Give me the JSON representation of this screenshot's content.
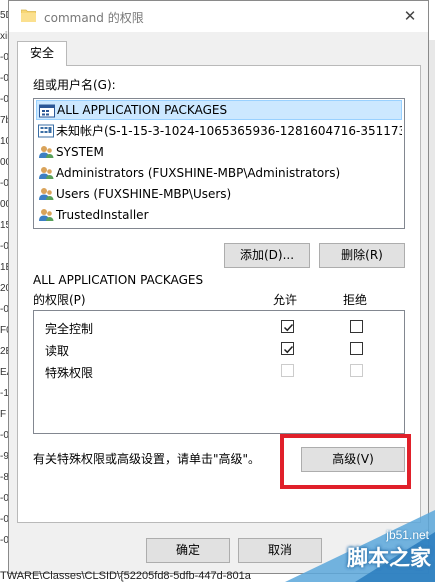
{
  "window": {
    "title": "command 的权限",
    "close_glyph": "✕"
  },
  "tabs": [
    {
      "label": "安全",
      "active": true
    }
  ],
  "group_label": "组或用户名(G):",
  "principals": [
    {
      "name": "ALL APPLICATION PACKAGES",
      "icon": "app-packages-icon",
      "selected": true
    },
    {
      "name": "未知帐户(S-1-15-3-1024-1065365936-1281604716-351173…",
      "icon": "unknown-account-icon",
      "selected": false
    },
    {
      "name": "SYSTEM",
      "icon": "users-icon",
      "selected": false
    },
    {
      "name": "Administrators (FUXSHINE-MBP\\Administrators)",
      "icon": "users-icon",
      "selected": false
    },
    {
      "name": "Users (FUXSHINE-MBP\\Users)",
      "icon": "users-icon",
      "selected": false
    },
    {
      "name": "TrustedInstaller",
      "icon": "users-icon",
      "selected": false
    }
  ],
  "buttons": {
    "add": "添加(D)...",
    "remove": "删除(R)",
    "advanced": "高级(V)",
    "ok": "确定",
    "cancel": "取消"
  },
  "permissions_for": "ALL APPLICATION PACKAGES",
  "permissions_label": "的权限(P)",
  "allow_header": "允许",
  "deny_header": "拒绝",
  "permissions": [
    {
      "name": "完全控制",
      "allow": true,
      "deny": false,
      "disabled": false
    },
    {
      "name": "读取",
      "allow": true,
      "deny": false,
      "disabled": false
    },
    {
      "name": "特殊权限",
      "allow": false,
      "deny": false,
      "disabled": true
    }
  ],
  "advanced_hint": "有关特殊权限或高级设置，请单击\"高级\"。",
  "background": {
    "left_fragments": [
      "5D",
      "xiii",
      "-0",
      "-0",
      "-0",
      "7b",
      "10",
      "00",
      "-0",
      "00",
      "15",
      "-0",
      "1E",
      "20",
      "-0",
      "F0",
      "2E",
      "EA",
      "-1",
      "F",
      "-0",
      "-9",
      "-8",
      "-0",
      "-0",
      "-0"
    ],
    "bottom_path": "TWARE\\Classes\\CLSID\\{52205fd8-5dfb-447d-801a"
  },
  "watermark": {
    "domain": "jb51.net",
    "name": "脚本之家"
  },
  "colors": {
    "highlight_border": "#e0202a",
    "selection_bg": "#cce8ff",
    "dialog_bg": "#f0f0f0"
  }
}
